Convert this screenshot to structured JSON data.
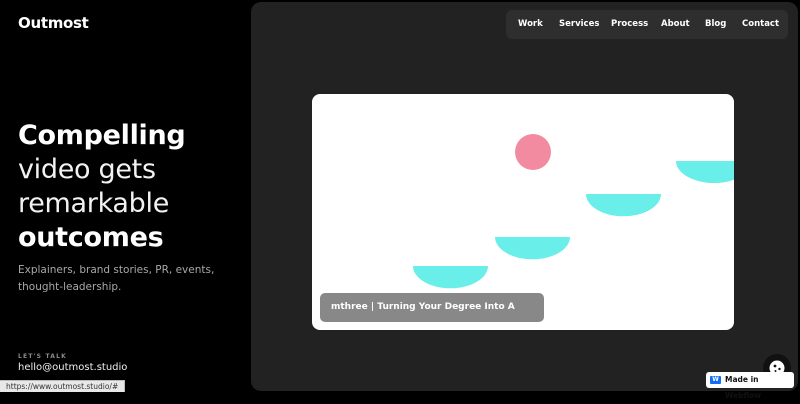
{
  "brand": {
    "logo": "Outmost"
  },
  "hero": {
    "line1": "Compelling",
    "line2": "video gets",
    "line3": "remarkable",
    "line4": "outcomes",
    "subtitle": "Explainers, brand stories, PR, events, thought-leadership."
  },
  "contact": {
    "label": "LET'S TALK",
    "email": "hello@outmost.studio"
  },
  "status_bar": {
    "url": "https://www.outmost.studio/#"
  },
  "nav": {
    "items": [
      "Work",
      "Services",
      "Process",
      "About",
      "Blog",
      "Contact"
    ]
  },
  "video": {
    "caption": "mthree | Turning Your Degree Into A Career"
  },
  "badge": {
    "label": "Made in Webflow"
  },
  "icons": {
    "cookie": "cookie-icon",
    "webflow": "webflow-logo-icon"
  },
  "colors": {
    "accent_cyan": "#6aeeea",
    "accent_pink": "#f28aa0",
    "panel": "#222222",
    "nav_bg": "#2e2e2e",
    "webflow_blue": "#146ef5"
  }
}
